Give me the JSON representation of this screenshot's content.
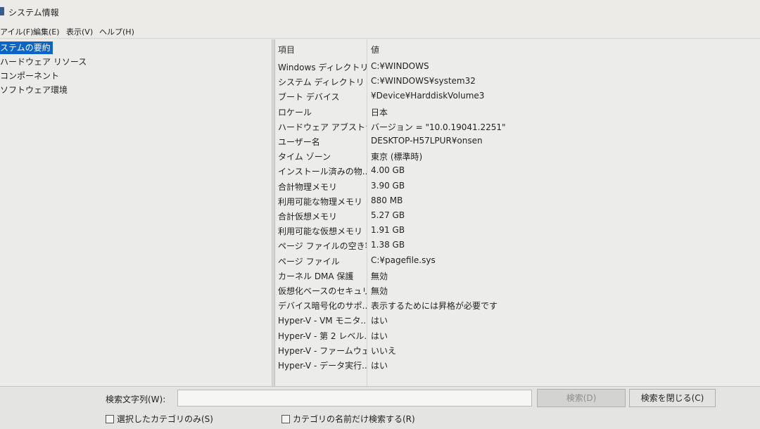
{
  "window": {
    "title": "システム情報"
  },
  "menu": [
    "アイル(F)",
    "編集(E)",
    "表示(V)",
    "ヘルプ(H)"
  ],
  "tree": [
    {
      "label": "ステムの要約",
      "selected": true
    },
    {
      "label": "ハードウェア リソース"
    },
    {
      "label": "コンポーネント"
    },
    {
      "label": "ソフトウェア環境"
    }
  ],
  "table": {
    "headers": {
      "item": "項目",
      "value": "値"
    },
    "rows": [
      {
        "item": "Windows ディレクトリ",
        "value": "C:¥WINDOWS"
      },
      {
        "item": "システム ディレクトリ",
        "value": "C:¥WINDOWS¥system32"
      },
      {
        "item": "ブート デバイス",
        "value": "¥Device¥HarddiskVolume3"
      },
      {
        "item": "ロケール",
        "value": "日本"
      },
      {
        "item": "ハードウェア アブストラク...",
        "value": "バージョン = \"10.0.19041.2251\""
      },
      {
        "item": "ユーザー名",
        "value": "DESKTOP-H57LPUR¥onsen"
      },
      {
        "item": "タイム ゾーン",
        "value": "東京 (標準時)"
      },
      {
        "item": "インストール済みの物...",
        "value": "4.00 GB"
      },
      {
        "item": "合計物理メモリ",
        "value": "3.90 GB"
      },
      {
        "item": "利用可能な物理メモリ",
        "value": "880 MB"
      },
      {
        "item": "合計仮想メモリ",
        "value": "5.27 GB"
      },
      {
        "item": "利用可能な仮想メモリ",
        "value": "1.91 GB"
      },
      {
        "item": "ページ ファイルの空き容...",
        "value": "1.38 GB"
      },
      {
        "item": "ページ ファイル",
        "value": "C:¥pagefile.sys"
      },
      {
        "item": "カーネル DMA 保護",
        "value": "無効"
      },
      {
        "item": "仮想化ベースのセキュリ...",
        "value": "無効"
      },
      {
        "item": "デバイス暗号化のサポ...",
        "value": "表示するためには昇格が必要です"
      },
      {
        "item": "Hyper-V - VM モニタ...",
        "value": "はい"
      },
      {
        "item": "Hyper-V - 第 2 レベル...",
        "value": "はい"
      },
      {
        "item": "Hyper-V - ファームウェ...",
        "value": "いいえ"
      },
      {
        "item": "Hyper-V - データ実行...",
        "value": "はい"
      }
    ]
  },
  "search": {
    "label": "検索文字列(W):",
    "value": "",
    "search_button": "検索(D)",
    "close_button": "検索を閉じる(C)",
    "option_selected_only": "選択したカテゴリのみ(S)",
    "option_names_only": "カテゴリの名前だけ検索する(R)"
  }
}
